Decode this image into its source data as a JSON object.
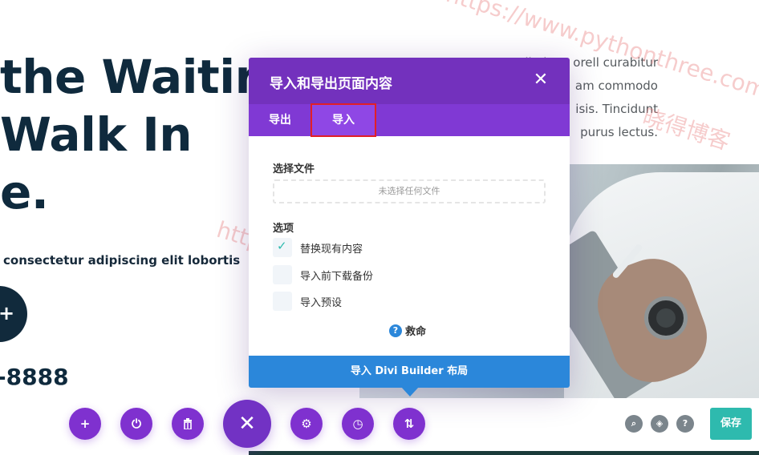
{
  "background": {
    "hero_lines": [
      " the Waitir",
      "Walk In",
      "e."
    ],
    "subtitle": " consectetur adipiscing elit lobortis",
    "circle_icon": "+",
    "phone": "-8888",
    "right_text": [
      "Edimit ac orell curabitur",
      "am commodo",
      "isis. Tincidunt",
      "purus lectus."
    ]
  },
  "watermarks": [
    "https://www.pythonthree.com",
    "晓得博客",
    "https://www.pythonthree.com",
    "晓得博客"
  ],
  "modal": {
    "title": "导入和导出页面内容",
    "close_icon": "✕",
    "tabs": [
      {
        "label": "导出",
        "active": false
      },
      {
        "label": "导入",
        "active": true
      }
    ],
    "file_label": "选择文件",
    "file_placeholder": "未选择任何文件",
    "options_label": "选项",
    "options": [
      {
        "label": "替换现有内容",
        "checked": true
      },
      {
        "label": "导入前下载备份",
        "checked": false
      },
      {
        "label": "导入预设",
        "checked": false
      }
    ],
    "help_icon": "?",
    "help_label": "救命",
    "import_button": "导入 Divi Builder 布局"
  },
  "toolbar": {
    "buttons": [
      {
        "icon": "plus-icon",
        "glyph": "+"
      },
      {
        "icon": "power-icon",
        "glyph": "⏻"
      },
      {
        "icon": "trash-icon",
        "glyph": "🗑"
      },
      {
        "icon": "close-icon",
        "glyph": "✕"
      },
      {
        "icon": "gear-icon",
        "glyph": "⚙"
      },
      {
        "icon": "history-icon",
        "glyph": "◷"
      },
      {
        "icon": "portability-icon",
        "glyph": "⇅"
      }
    ],
    "right_icons": [
      {
        "icon": "zoom-icon",
        "glyph": "⌕"
      },
      {
        "icon": "layers-icon",
        "glyph": "◈"
      },
      {
        "icon": "help-icon",
        "glyph": "?"
      }
    ],
    "save_label": "保存"
  },
  "colors": {
    "modal_header": "#7331bd",
    "tabs_bar": "#8039d4",
    "import_button": "#2b87da",
    "save_button": "#2ebaae",
    "toolbar_purple": "#7f31cf"
  }
}
